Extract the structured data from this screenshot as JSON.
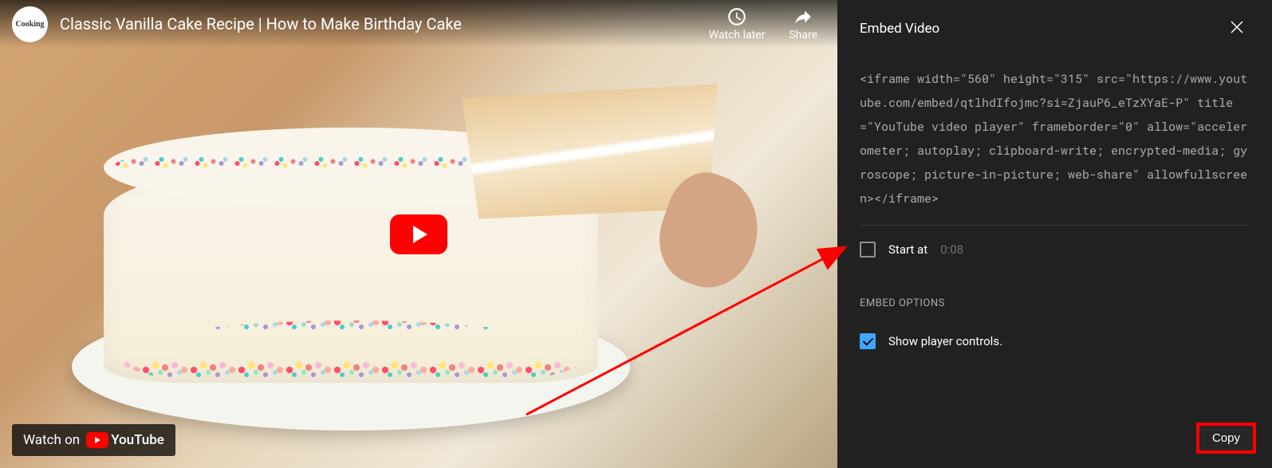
{
  "video": {
    "title": "Classic Vanilla Cake Recipe | How to Make Birthday Cake",
    "channel_logo_text": "Cooking",
    "watch_later_label": "Watch later",
    "share_label": "Share",
    "watch_on_label": "Watch on",
    "platform_name": "YouTube"
  },
  "panel": {
    "title": "Embed Video",
    "embed_code": "<iframe width=\"560\" height=\"315\" src=\"https://www.youtube.com/embed/qtlhdIfojmc?si=ZjauP6_eTzXYaE-P\" title=\"YouTube video player\" frameborder=\"0\" allow=\"accelerometer; autoplay; clipboard-write; encrypted-media; gyroscope; picture-in-picture; web-share\" allowfullscreen></iframe>",
    "start_at": {
      "label": "Start at",
      "time": "0:08",
      "checked": false
    },
    "options_heading": "EMBED OPTIONS",
    "show_controls": {
      "label": "Show player controls.",
      "checked": true
    },
    "copy_label": "Copy"
  }
}
